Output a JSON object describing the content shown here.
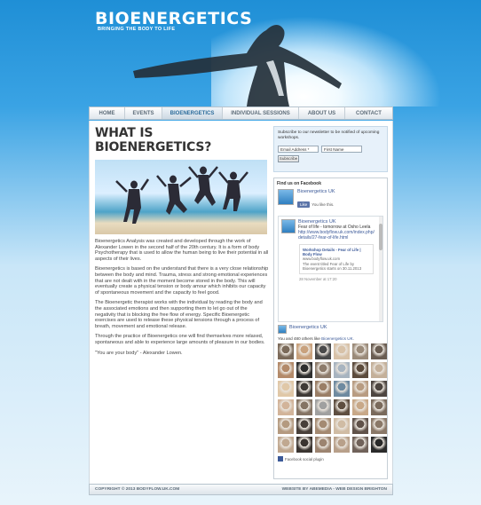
{
  "header": {
    "logo": "BIOENERGETICS",
    "tagline": "BRINGING THE BODY TO LIFE"
  },
  "nav": {
    "items": [
      {
        "label": "HOME"
      },
      {
        "label": "EVENTS"
      },
      {
        "label": "BIOENERGETICS"
      },
      {
        "label": "INDIVIDUAL SESSIONS"
      },
      {
        "label": "ABOUT US"
      },
      {
        "label": "CONTACT"
      }
    ],
    "active": "BIOENERGETICS"
  },
  "main": {
    "title": "WHAT IS BIOENERGETICS?",
    "paragraphs": [
      "Bioenergetics Analysis was created and developed through the work of Alexander Lowen in the second half of the 20th century. It is a form of body Psychotherapy that is used to allow the human being to live their potential in all aspects of their lives.",
      "Bioenergetics is based on the understand that there is a very close relationship between the body and mind. Trauma, stress and strong emotional experiences that are not dealt with in the moment become stored in the body. This will eventually create a physical tension or body amour which inhibits our capacity of spontaneous movement and the capacity to feel good.",
      "The Bioenergetic therapist works with the individual by reading the body and the associated emotions and then supporting them to let go out of the negativity that is blocking the free flow of energy. Specific Bioenergetic exercises are used to release these physical tensions through a process of breath, movement and emotional release.",
      "Through the practice of Bioenergetics one will find themselves more relaxed, spontaneous and able to experience large amounts of pleasure in our bodies.",
      "\"You are your body\" - Alexander Lowen."
    ]
  },
  "newsletter": {
    "text": "Subscribe to our newsletter to be notified of upcoming workshops.",
    "email_value": "Email Address *",
    "name_value": "First Name",
    "subscribe_label": "Subscribe"
  },
  "facebook": {
    "heading": "Find us on Facebook",
    "page_name": "Bioenergetics UK",
    "like_label": "Like",
    "like_note": "You like this.",
    "post_author": "Bioenergetics UK",
    "post_text": "Fear of life - tomorrow at Osho Leela",
    "post_link": "http://www.bodyflow.uk.com/index.php/details/27-fear-of-life.html",
    "card_title": "Workshop Details - Fear of Life | Body Flow",
    "card_url": "www.bodyflow.uk.com",
    "card_desc": "The event titled Fear of Life by Bioenergetics starts on 30.11.2013",
    "post_date": "28 November at 17:20",
    "post2_author": "Bioenergetics UK",
    "fans_text": "You and 480 others like",
    "fans_link": "Bioenergetics UK.",
    "plugin_label": "Facebook social plugin",
    "fan_colors": [
      "#7b6a5a",
      "#c9a27e",
      "#4a4a4a",
      "#d8c2a8",
      "#9b8b7a",
      "#6a5d52",
      "#b38a6a",
      "#2e2e2e",
      "#8d7b6b",
      "#a8b4c0",
      "#5c4b3c",
      "#c4b09a",
      "#e0c8a8",
      "#3f3a36",
      "#9a7e66",
      "#6e8aa0",
      "#b89c82",
      "#4d4540",
      "#d2b49a",
      "#857464",
      "#a0a0a0",
      "#5e4e40",
      "#c8a888",
      "#7a6a5c",
      "#b49a80",
      "#48403a",
      "#a48a72",
      "#d0bca4",
      "#60524a",
      "#8a7868",
      "#c0a890",
      "#3a3430",
      "#9c8470",
      "#b8a08a",
      "#70625a",
      "#2a2a2a"
    ]
  },
  "footer": {
    "copyright": "COPYRIGHT © 2013 BODYFLOW.UK.COM",
    "credit": "WEBSITE BY ABEMEDIA - WEB DESIGN BRIGHTON"
  }
}
